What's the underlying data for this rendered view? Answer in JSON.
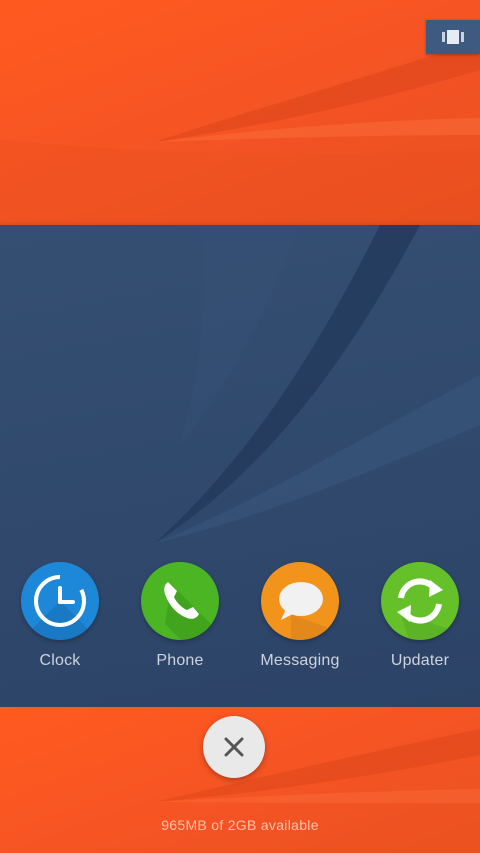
{
  "colors": {
    "accent_orange": "#f45324",
    "panel_navy": "#304a6e",
    "clock": "#1e88d8",
    "phone": "#4cb523",
    "messaging": "#f2941b",
    "updater": "#66c02a"
  },
  "top_bar": {
    "recents_icon": "cards-stack-icon"
  },
  "dock": {
    "apps": [
      {
        "label": "Clock",
        "icon": "clock-icon"
      },
      {
        "label": "Phone",
        "icon": "phone-icon"
      },
      {
        "label": "Messaging",
        "icon": "speech-bubble-icon"
      },
      {
        "label": "Updater",
        "icon": "sync-arrows-icon"
      }
    ]
  },
  "footer": {
    "close_icon": "close-icon",
    "memory_status": "965MB of 2GB available"
  }
}
